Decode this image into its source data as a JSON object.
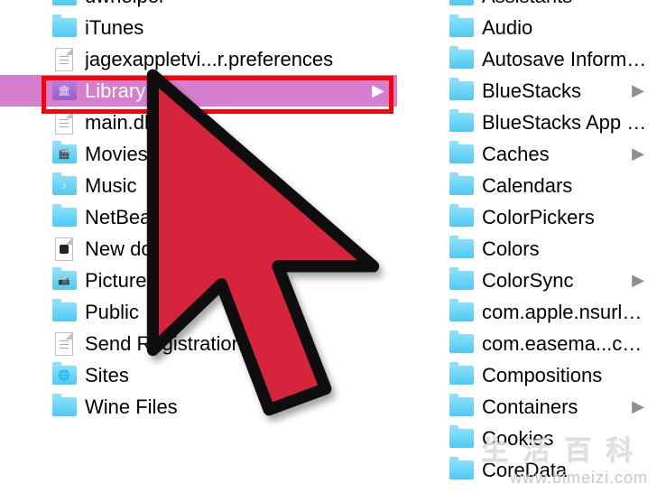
{
  "watermark": {
    "cn_text": "生活百科",
    "url_text": "www.bimeizi.com"
  },
  "cursor": {
    "fill_color": "#d6243c",
    "stroke_color": "#0e0e0e"
  },
  "highlight": {
    "color": "#ff0007"
  },
  "left_column": [
    {
      "name": "dwhelper",
      "type": "folder",
      "partial_top": true
    },
    {
      "name": "iTunes",
      "type": "folder"
    },
    {
      "name": "jagexappletvi...r.preferences",
      "type": "doc-lines"
    },
    {
      "name": "Library",
      "type": "folder-library",
      "selected": true,
      "has_children": true
    },
    {
      "name": "main.db",
      "type": "doc-lines"
    },
    {
      "name": "Movies",
      "type": "folder",
      "glyph": "🎬"
    },
    {
      "name": "Music",
      "type": "folder",
      "glyph": "♪"
    },
    {
      "name": "NetBeansPro",
      "type": "folder"
    },
    {
      "name": "New docume...",
      "type": "doc-exec"
    },
    {
      "name": "Pictures",
      "type": "folder",
      "glyph": "📷"
    },
    {
      "name": "Public",
      "type": "folder"
    },
    {
      "name": "Send Registration",
      "type": "doc-lines"
    },
    {
      "name": "Sites",
      "type": "folder",
      "glyph": "🌐"
    },
    {
      "name": "Wine Files",
      "type": "folder"
    }
  ],
  "right_column": [
    {
      "name": "Assistants",
      "type": "folder",
      "partial_top": true
    },
    {
      "name": "Audio",
      "type": "folder"
    },
    {
      "name": "Autosave Informatio",
      "type": "folder"
    },
    {
      "name": "BlueStacks",
      "type": "folder",
      "has_children": true
    },
    {
      "name": "BlueStacks App Play",
      "type": "folder"
    },
    {
      "name": "Caches",
      "type": "folder",
      "has_children": true
    },
    {
      "name": "Calendars",
      "type": "folder"
    },
    {
      "name": "ColorPickers",
      "type": "folder"
    },
    {
      "name": "Colors",
      "type": "folder"
    },
    {
      "name": "ColorSync",
      "type": "folder",
      "has_children": true
    },
    {
      "name": "com.apple.nsurlsess",
      "type": "folder"
    },
    {
      "name": "com.easema...cClea",
      "type": "folder"
    },
    {
      "name": "Compositions",
      "type": "folder"
    },
    {
      "name": "Containers",
      "type": "folder",
      "has_children": true
    },
    {
      "name": "Cookies",
      "type": "folder"
    },
    {
      "name": "CoreData",
      "type": "folder",
      "partial_bottom": true
    }
  ]
}
